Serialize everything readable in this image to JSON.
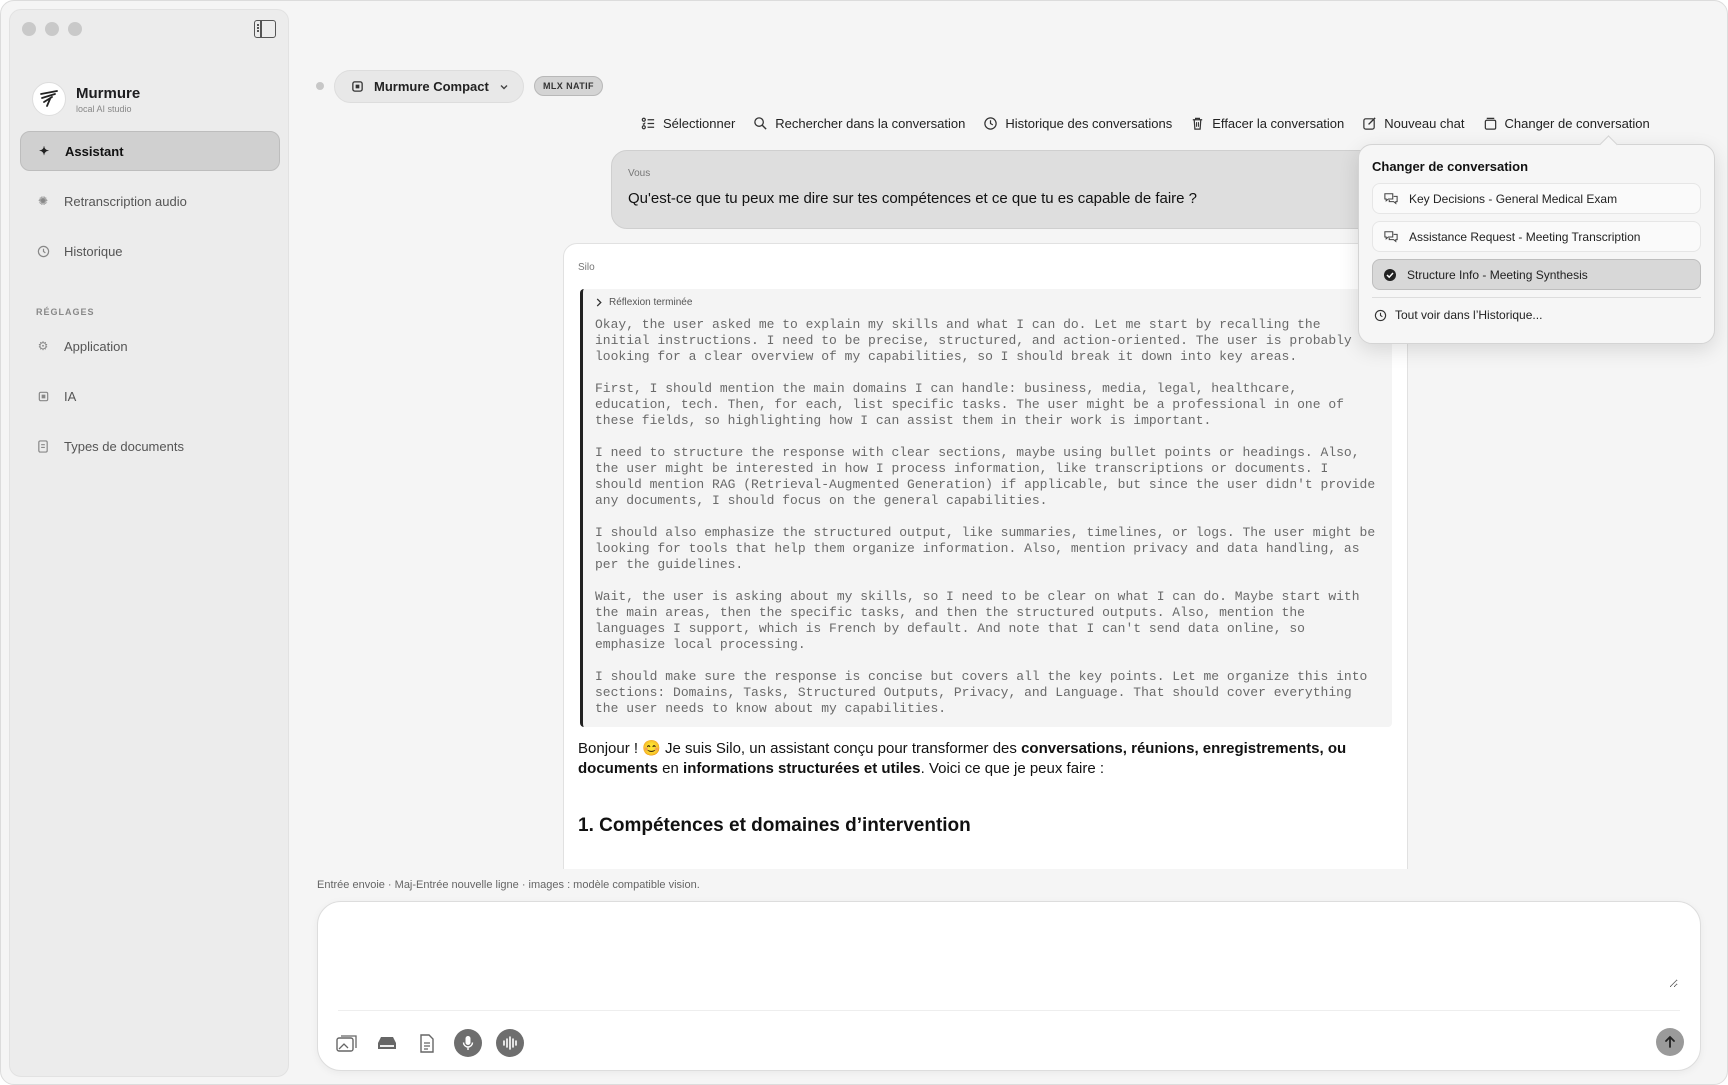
{
  "app": {
    "name": "Murmure",
    "subtitle": "local AI studio"
  },
  "sidebar": {
    "items": [
      {
        "label": "Assistant",
        "icon": "sparkle-icon",
        "active": true
      },
      {
        "label": "Retranscription audio",
        "icon": "waveform-icon",
        "active": false
      },
      {
        "label": "Historique",
        "icon": "clock-icon",
        "active": false
      }
    ],
    "section_label": "RÉGLAGES",
    "settings_items": [
      {
        "label": "Application",
        "icon": "gear-icon"
      },
      {
        "label": "IA",
        "icon": "chip-icon"
      },
      {
        "label": "Types de documents",
        "icon": "document-icon"
      }
    ]
  },
  "header": {
    "model_name": "Murmure Compact",
    "badge": "MLX NATIF"
  },
  "toolbar": {
    "select": "Sélectionner",
    "search": "Rechercher dans la conversation",
    "history": "Historique des conversations",
    "clear": "Effacer la conversation",
    "new_chat": "Nouveau chat",
    "switch": "Changer de conversation"
  },
  "conversation": {
    "user_label": "Vous",
    "user_message": "Qu'est-ce que tu peux me dire sur tes compétences et ce que tu es capable de faire ?",
    "assistant_label": "Silo",
    "reasoning_label": "Réflexion terminée",
    "reasoning": [
      "Okay, the user asked me to explain my skills and what I can do. Let me start by recalling the initial instructions. I need to be precise, structured, and action-oriented. The user is probably looking for a clear overview of my capabilities, so I should break it down into key areas.",
      "First, I should mention the main domains I can handle: business, media, legal, healthcare, education, tech. Then, for each, list specific tasks. The user might be a professional in one of these fields, so highlighting how I can assist them in their work is important.",
      "I need to structure the response with clear sections, maybe using bullet points or headings. Also, the user might be interested in how I process information, like transcriptions or documents. I should mention RAG (Retrieval-Augmented Generation) if applicable, but since the user didn't provide any documents, I should focus on the general capabilities.",
      "I should also emphasize the structured output, like summaries, timelines, or logs. The user might be looking for tools that help them organize information. Also, mention privacy and data handling, as per the guidelines.",
      "Wait, the user is asking about my skills, so I need to be clear on what I can do. Maybe start with the main areas, then the specific tasks, and then the structured outputs. Also, mention the languages I support, which is French by default. And note that I can't send data online, so emphasize local processing.",
      "I should make sure the response is concise but covers all the key points. Let me organize this into sections: Domains, Tasks, Structured Outputs, Privacy, and Language. That should cover everything the user needs to know about my capabilities."
    ],
    "answer_intro_1": "Bonjour ! 😊  Je suis Silo, un assistant conçu pour transformer des ",
    "answer_bold_1": "conversations, réunions, enregistrements, ou documents",
    "answer_mid": " en ",
    "answer_bold_2": "informations structurées et utiles",
    "answer_end": ". Voici ce que je peux faire :",
    "answer_heading": "1. Compétences et domaines d’intervention"
  },
  "dropdown": {
    "title": "Changer de conversation",
    "items": [
      {
        "label": "Key Decisions - General Medical Exam",
        "selected": false
      },
      {
        "label": "Assistance Request - Meeting Transcription",
        "selected": false
      },
      {
        "label": "Structure Info - Meeting Synthesis",
        "selected": true
      }
    ],
    "footer": "Tout voir dans l’Historique..."
  },
  "composer": {
    "hint": "Entrée envoie · Maj-Entrée nouvelle ligne · images : modèle compatible vision.",
    "value": "",
    "placeholder": ""
  }
}
